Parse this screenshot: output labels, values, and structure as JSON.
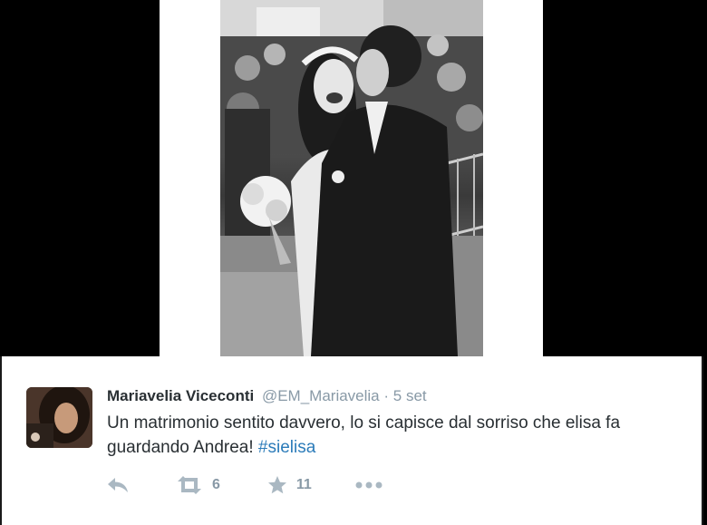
{
  "tweet": {
    "author_name": "Mariavelia Viceconti",
    "handle": "@EM_Mariavelia",
    "separator": "·",
    "time": "5 set",
    "text": "Un matrimonio sentito davvero, lo si capisce dal sorriso che elisa fa guardando Andrea!",
    "hashtag": "#sielisa"
  },
  "actions": {
    "reply_icon": "reply-icon",
    "retweet_icon": "retweet-icon",
    "retweet_count": "6",
    "favorite_icon": "star-icon",
    "favorite_count": "11",
    "more_icon": "more-dots-icon"
  },
  "colors": {
    "name": "#292f33",
    "meta": "#8899a6",
    "hashtag": "#2b7bb9",
    "action_icons": "#aab8c2",
    "background": "#000000",
    "card": "#ffffff"
  }
}
